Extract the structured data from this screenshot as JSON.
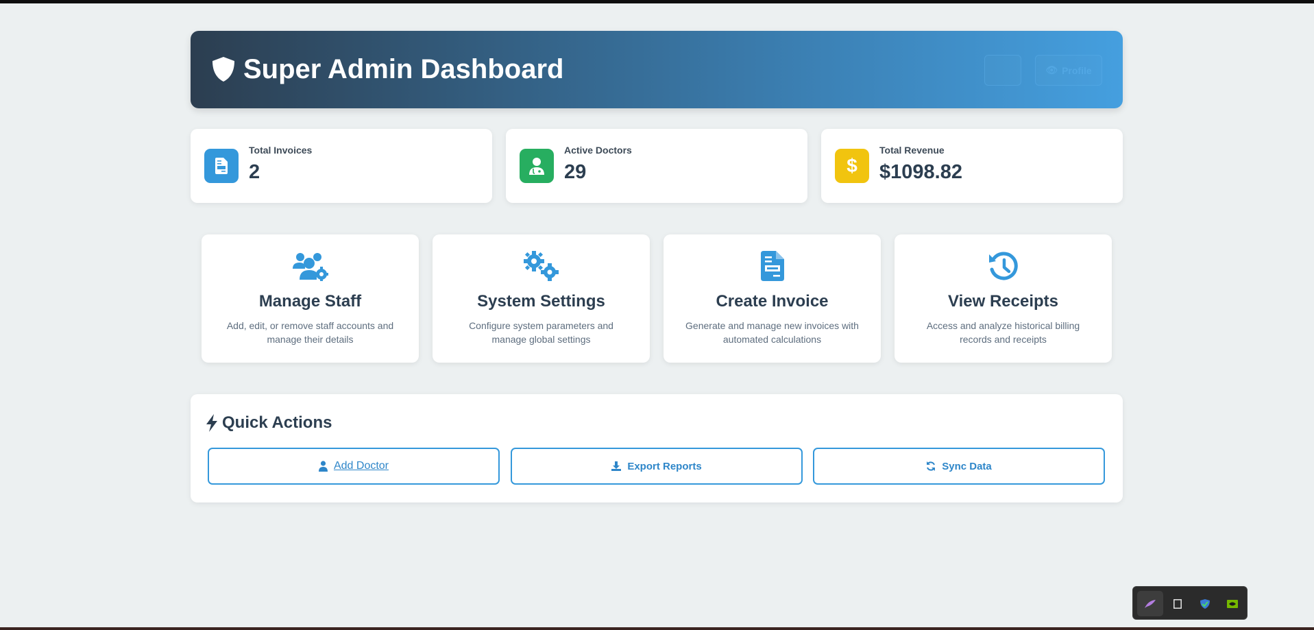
{
  "header": {
    "title": "Super Admin Dashboard",
    "icon": "shield-icon",
    "gradient_start": "#2c3e50",
    "gradient_end": "#459fdf",
    "ghost_button_label": "Profile"
  },
  "stats": [
    {
      "label": "Total Invoices",
      "value": "2",
      "icon": "invoice-icon",
      "color": "#3498db"
    },
    {
      "label": "Active Doctors",
      "value": "29",
      "icon": "doctor-icon",
      "color": "#27ae60"
    },
    {
      "label": "Total Revenue",
      "value": "$1098.82",
      "icon": "dollar-icon",
      "color": "#f1c40f"
    }
  ],
  "features": [
    {
      "title": "Manage Staff",
      "description": "Add, edit, or remove staff accounts and manage their details",
      "icon": "users-cog-icon"
    },
    {
      "title": "System Settings",
      "description": "Configure system parameters and manage global settings",
      "icon": "cogs-icon"
    },
    {
      "title": "Create Invoice",
      "description": "Generate and manage new invoices with automated calculations",
      "icon": "invoice-icon"
    },
    {
      "title": "View Receipts",
      "description": "Access and analyze historical billing records and receipts",
      "icon": "history-icon"
    }
  ],
  "quick_actions": {
    "title": "Quick Actions",
    "icon": "bolt-icon",
    "buttons": [
      {
        "label": "Add Doctor",
        "icon": "user-doctor-icon"
      },
      {
        "label": "Export Reports",
        "icon": "download-icon"
      },
      {
        "label": "Sync Data",
        "icon": "sync-icon"
      }
    ]
  },
  "accent_color": "#3498db",
  "tray": {
    "items": [
      "feather-icon",
      "notepad-icon",
      "security-shield-icon",
      "nvidia-icon"
    ]
  }
}
